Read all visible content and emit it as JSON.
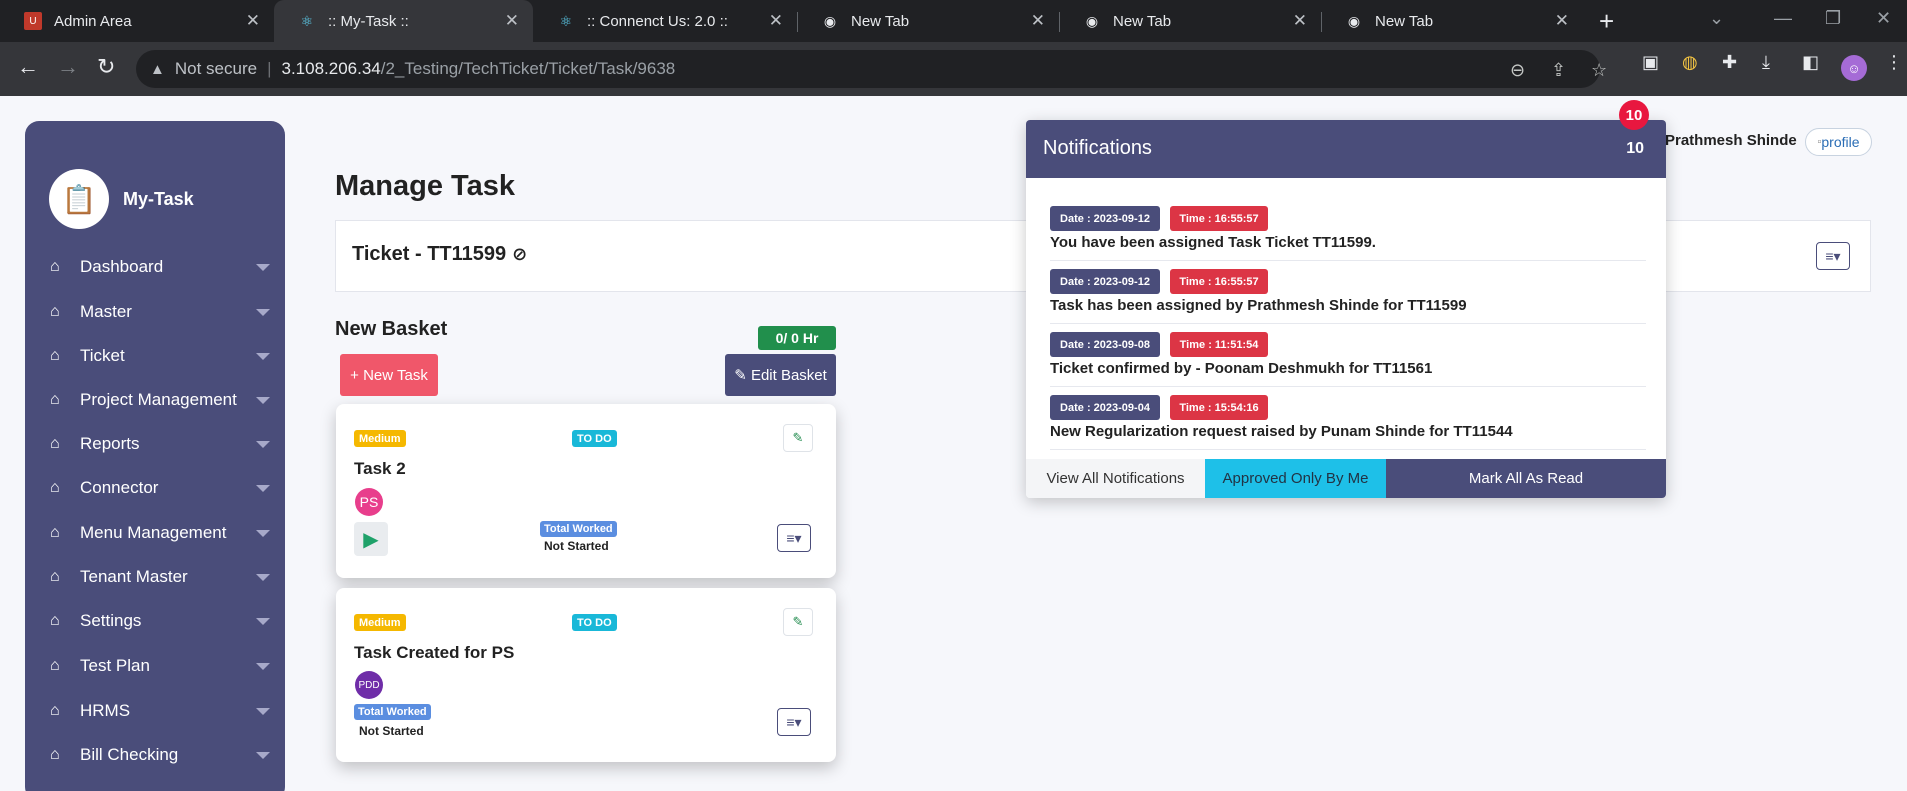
{
  "browser": {
    "tabs": [
      {
        "title": "Admin Area",
        "icon": "admin-favicon"
      },
      {
        "title": ":: My-Task ::",
        "icon": "react-favicon"
      },
      {
        "title": ":: Connenct Us: 2.0 ::",
        "icon": "react-favicon"
      },
      {
        "title": "New Tab",
        "icon": "chrome-favicon"
      },
      {
        "title": "New Tab",
        "icon": "chrome-favicon"
      },
      {
        "title": "New Tab",
        "icon": "chrome-favicon"
      }
    ],
    "security_label": "Not secure",
    "url_host": "3.108.206.34",
    "url_path": "/2_Testing/TechTicket/Ticket/Task/9638"
  },
  "sidebar": {
    "brand": "My-Task",
    "items": [
      {
        "label": "Dashboard"
      },
      {
        "label": "Master"
      },
      {
        "label": "Ticket"
      },
      {
        "label": "Project Management"
      },
      {
        "label": "Reports"
      },
      {
        "label": "Connector"
      },
      {
        "label": "Menu Management"
      },
      {
        "label": "Tenant Master"
      },
      {
        "label": "Settings"
      },
      {
        "label": "Test Plan"
      },
      {
        "label": "HRMS"
      },
      {
        "label": "Bill Checking"
      }
    ]
  },
  "header": {
    "notification_count": "10",
    "user_name": "Prathmesh Shinde",
    "profile_alt": "profile"
  },
  "main": {
    "page_title": "Manage Task",
    "ticket_title": "Ticket - TT11599",
    "basket": {
      "title": "New Basket",
      "hours": "0/ 0 Hr",
      "new_task_label": "New Task",
      "edit_basket_label": "Edit Basket"
    },
    "tasks": [
      {
        "priority": "Medium",
        "status": "TO DO",
        "name": "Task 2",
        "assignee": "PS",
        "assignee_color": "#e83e8c",
        "worked_label": "Total Worked",
        "worked_value": "Not Started"
      },
      {
        "priority": "Medium",
        "status": "TO DO",
        "name": "Task Created for PS",
        "assignee": "PDD",
        "assignee_color": "#6f2da8",
        "worked_label": "Total Worked",
        "worked_value": "Not Started"
      }
    ]
  },
  "notifications": {
    "title": "Notifications",
    "count": "10",
    "items": [
      {
        "date": "Date : 2023-09-12",
        "time": "Time : 16:55:57",
        "message": "You have been assigned Task Ticket TT11599."
      },
      {
        "date": "Date : 2023-09-12",
        "time": "Time : 16:55:57",
        "message": "Task has been assigned by Prathmesh Shinde for TT11599"
      },
      {
        "date": "Date : 2023-09-08",
        "time": "Time : 11:51:54",
        "message": "Ticket confirmed by - Poonam Deshmukh for TT11561"
      },
      {
        "date": "Date : 2023-09-04",
        "time": "Time : 15:54:16",
        "message": "New Regularization request raised by Punam Shinde for TT11544"
      }
    ],
    "view_all_label": "View All Notifications",
    "approved_label": "Approved Only By Me",
    "mark_all_label": "Mark All As Read"
  },
  "colors": {
    "primary": "#4a4d7a",
    "danger": "#dc3545",
    "success": "#218f4c",
    "info": "#1ec0e8",
    "warning": "#f5b800"
  }
}
